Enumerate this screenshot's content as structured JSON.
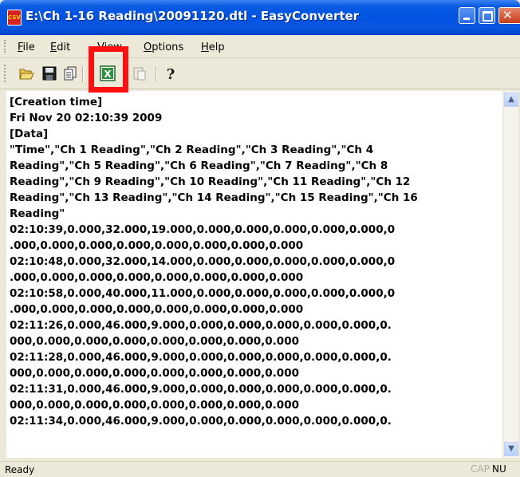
{
  "window": {
    "title": "E:\\Ch 1-16 Reading\\20091120.dtl - EasyConverter",
    "app_icon": "easyconverter-csv-icon",
    "app_icon_text": "CSV",
    "controls": {
      "minimize": "minimize-icon",
      "maximize": "maximize-icon",
      "close": "close-icon",
      "close_glyph": "✕"
    }
  },
  "menu": {
    "items": [
      {
        "label": "File",
        "accel": "F",
        "rest": "ile"
      },
      {
        "label": "Edit",
        "accel": "E",
        "rest": "dit"
      },
      {
        "label": "View",
        "accel": "V",
        "rest": "iew"
      },
      {
        "label": "Options",
        "accel": "O",
        "rest": "ptions"
      },
      {
        "label": "Help",
        "accel": "H",
        "rest": "elp"
      }
    ]
  },
  "toolbar": {
    "buttons": [
      "open-folder-icon",
      "save-icon",
      "copy-icon",
      "excel-export-icon",
      "paste-icon",
      "help-icon"
    ],
    "help_glyph": "?",
    "excel_glyph": "X"
  },
  "highlight_color": "#ff1010",
  "content": {
    "lines": [
      "[Creation time]",
      "Fri Nov 20 02:10:39 2009",
      "[Data]",
      "\"Time\",\"Ch 1 Reading\",\"Ch 2 Reading\",\"Ch 3 Reading\",\"Ch 4",
      "Reading\",\"Ch 5 Reading\",\"Ch 6 Reading\",\"Ch 7 Reading\",\"Ch 8",
      "Reading\",\"Ch 9 Reading\",\"Ch 10 Reading\",\"Ch 11 Reading\",\"Ch 12",
      "Reading\",\"Ch 13 Reading\",\"Ch 14 Reading\",\"Ch 15 Reading\",\"Ch 16",
      "Reading\"",
      "02:10:39,0.000,32.000,19.000,0.000,0.000,0.000,0.000,0.000,0",
      ".000,0.000,0.000,0.000,0.000,0.000,0.000,0.000",
      "02:10:48,0.000,32.000,14.000,0.000,0.000,0.000,0.000,0.000,0",
      ".000,0.000,0.000,0.000,0.000,0.000,0.000,0.000",
      "02:10:58,0.000,40.000,11.000,0.000,0.000,0.000,0.000,0.000,0",
      ".000,0.000,0.000,0.000,0.000,0.000,0.000,0.000",
      "02:11:26,0.000,46.000,9.000,0.000,0.000,0.000,0.000,0.000,0.",
      "000,0.000,0.000,0.000,0.000,0.000,0.000,0.000",
      "02:11:28,0.000,46.000,9.000,0.000,0.000,0.000,0.000,0.000,0.",
      "000,0.000,0.000,0.000,0.000,0.000,0.000,0.000",
      "02:11:31,0.000,46.000,9.000,0.000,0.000,0.000,0.000,0.000,0.",
      "000,0.000,0.000,0.000,0.000,0.000,0.000,0.000",
      "02:11:34,0.000,46.000,9.000,0.000,0.000,0.000,0.000,0.000,0."
    ]
  },
  "scrollbar": {
    "up_icon": "scroll-up-icon",
    "down_icon": "scroll-down-icon"
  },
  "status": {
    "text": "Ready",
    "cap": "CAP",
    "num": "NU"
  }
}
